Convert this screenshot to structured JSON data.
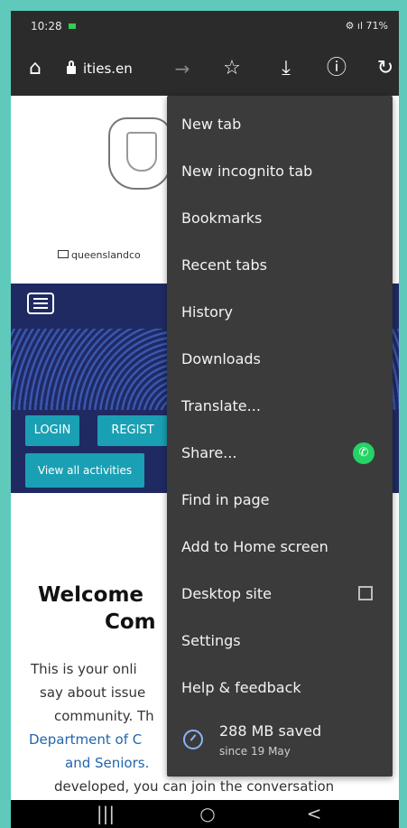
{
  "status": {
    "time": "10:28",
    "right": "⚙ ıl 71%"
  },
  "toolbar": {
    "url": "ities.en",
    "icons": [
      "home-icon",
      "lock-icon",
      "forward-icon",
      "star-icon",
      "download-icon",
      "info-icon",
      "refresh-icon"
    ]
  },
  "page": {
    "email": "queenslandco",
    "buttons": {
      "login": "LOGIN",
      "register": "REGIST",
      "activities": "View all activities"
    },
    "welcome_line1": "Welcome",
    "welcome_line2": "Com",
    "paragraph": {
      "line1": "This is your onli",
      "line2": "say about issue",
      "line3": "community. Th",
      "line4": "Department of C",
      "line5": "and Seniors.",
      "line6": "developed, you can join the conversation"
    }
  },
  "menu": {
    "items": [
      "New tab",
      "New incognito tab",
      "Bookmarks",
      "Recent tabs",
      "History",
      "Downloads",
      "Translate...",
      "Share...",
      "Find in page",
      "Add to Home screen",
      "Desktop site",
      "Settings",
      "Help & feedback"
    ],
    "saved": {
      "title": "288 MB saved",
      "subtitle": "since 19 May"
    }
  },
  "navbar": {
    "recent": "|||",
    "home": "○",
    "back": "<"
  }
}
